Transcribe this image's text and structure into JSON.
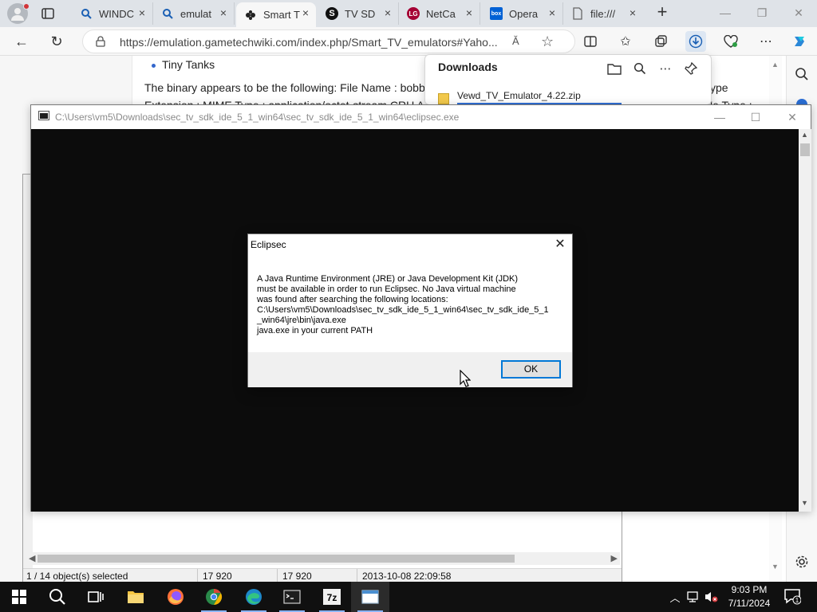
{
  "browser": {
    "tabs": [
      {
        "label": "WINDC",
        "icon": "search-icon",
        "active": false
      },
      {
        "label": "emulat",
        "icon": "search-icon",
        "active": false
      },
      {
        "label": "Smart T",
        "icon": "gamepad-icon",
        "active": true
      },
      {
        "label": "TV SD",
        "icon": "s-logo-icon",
        "active": false
      },
      {
        "label": "NetCa",
        "icon": "lg-logo-icon",
        "active": false
      },
      {
        "label": "Opera",
        "icon": "box-logo-icon",
        "active": false
      },
      {
        "label": "file:///",
        "icon": "file-icon",
        "active": false
      }
    ],
    "url": "https://emulation.gametechwiki.com/index.php/Smart_TV_emulators#Yaho...",
    "readaloud_label": "Ă"
  },
  "page": {
    "bullet_text": "Tiny Tanks",
    "paragraph_line1": "The binary appears to be the following: File Name : bobb",
    "paragraph_line2": "Extension : MIME Type : application/octet-stream CRU A",
    "right_text1": "ype",
    "right_text2": "le Type :"
  },
  "downloads": {
    "title": "Downloads",
    "item_name": "Vewd_TV_Emulator_4.22.zip"
  },
  "explorer": {
    "status_selected": "1 / 14 object(s) selected",
    "status_size": "17 920",
    "status_packed": "17 920",
    "status_modified": "2013-10-08 22:09:58"
  },
  "console": {
    "title": "C:\\Users\\vm5\\Downloads\\sec_tv_sdk_ide_5_1_win64\\sec_tv_sdk_ide_5_1_win64\\eclipsec.exe"
  },
  "dialog": {
    "title": "Eclipsec",
    "message_lines": [
      "A Java Runtime Environment (JRE) or Java Development Kit (JDK)",
      "must be available in order to run Eclipsec. No Java virtual machine",
      "was found after searching the following locations:",
      "C:\\Users\\vm5\\Downloads\\sec_tv_sdk_ide_5_1_win64\\sec_tv_sdk_ide_5_1",
      "_win64\\jre\\bin\\java.exe",
      "java.exe in your current PATH"
    ],
    "ok_label": "OK"
  },
  "taskbar": {
    "time": "9:03 PM",
    "date": "7/11/2024",
    "notification_count": "1"
  },
  "colors": {
    "accent": "#0078d7",
    "console_bg": "#0c0c0c",
    "taskbar_bg": "#101010"
  }
}
